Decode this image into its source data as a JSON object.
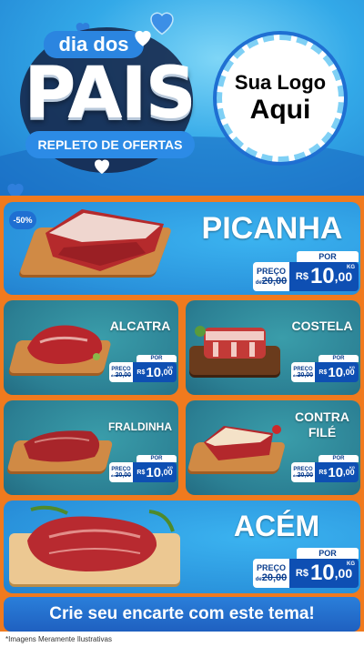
{
  "header": {
    "title_top": "dia dos",
    "title_main": "PAIS",
    "subtitle": "REPLETO DE OFERTAS",
    "logo_line1": "Sua Logo",
    "logo_line2": "Aqui"
  },
  "featured": {
    "discount_badge": "-50%",
    "name": "PICANHA",
    "por_label": "POR",
    "preco_label": "PREÇO",
    "old_prefix": "de",
    "old_price": "20,00",
    "currency": "R$",
    "price_int": "10",
    "price_dec": ",00",
    "unit": "KG"
  },
  "products": [
    {
      "name": "ALCATRA",
      "por_label": "POR",
      "preco_label": "PREÇO",
      "old_prefix": "de",
      "old_price": "20,00",
      "currency": "R$",
      "price_int": "10",
      "price_dec": ",00",
      "unit": "KG"
    },
    {
      "name": "COSTELA",
      "por_label": "POR",
      "preco_label": "PREÇO",
      "old_prefix": "de",
      "old_price": "20,00",
      "currency": "R$",
      "price_int": "10",
      "price_dec": ",00",
      "unit": "KG"
    },
    {
      "name": "FRALDINHA",
      "por_label": "POR",
      "preco_label": "PREÇO",
      "old_prefix": "de",
      "old_price": "20,00",
      "currency": "R$",
      "price_int": "10",
      "price_dec": ",00",
      "unit": "KG"
    },
    {
      "name_line1": "CONTRA",
      "name_line2": "FILÉ",
      "por_label": "POR",
      "preco_label": "PREÇO",
      "old_prefix": "de",
      "old_price": "20,00",
      "currency": "R$",
      "price_int": "10",
      "price_dec": ",00",
      "unit": "KG"
    }
  ],
  "bottom": {
    "name": "ACÉM",
    "por_label": "POR",
    "preco_label": "PREÇO",
    "old_prefix": "de",
    "old_price": "20,00",
    "currency": "R$",
    "price_int": "10",
    "price_dec": ",00",
    "unit": "KG"
  },
  "cta": "Crie seu encarte com este tema!",
  "disclaimer": "*Imagens Meramente Ilustrativas",
  "colors": {
    "background_orange": "#f07a1e",
    "panel_blue": "#2a93dc",
    "panel_teal": "#2b7f93",
    "price_blue": "#0e4fb3"
  }
}
